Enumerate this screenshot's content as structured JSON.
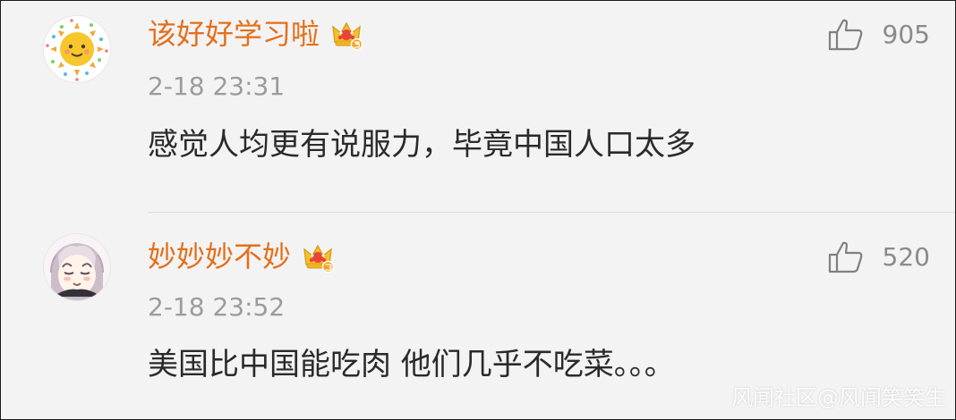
{
  "comments": [
    {
      "username": "该好好学习啦",
      "timestamp": "2-18 23:31",
      "text": "感觉人均更有说服力，毕竟中国人口太多",
      "likes": "905",
      "avatar": "sun-avatar",
      "badge": "crown-vip-5"
    },
    {
      "username": "妙妙妙不妙",
      "timestamp": "2-18 23:52",
      "text": "美国比中国能吃肉 他们几乎不吃菜。。。",
      "likes": "520",
      "avatar": "anime-girl-avatar",
      "badge": "crown-vip-3"
    }
  ],
  "watermark": "风闻社区@风闻笑笑生",
  "colors": {
    "background": "#f3f3f3",
    "username": "#e46f1b",
    "timestamp": "#9b9b9b",
    "text": "#2a2a2a",
    "icon": "#808080"
  }
}
